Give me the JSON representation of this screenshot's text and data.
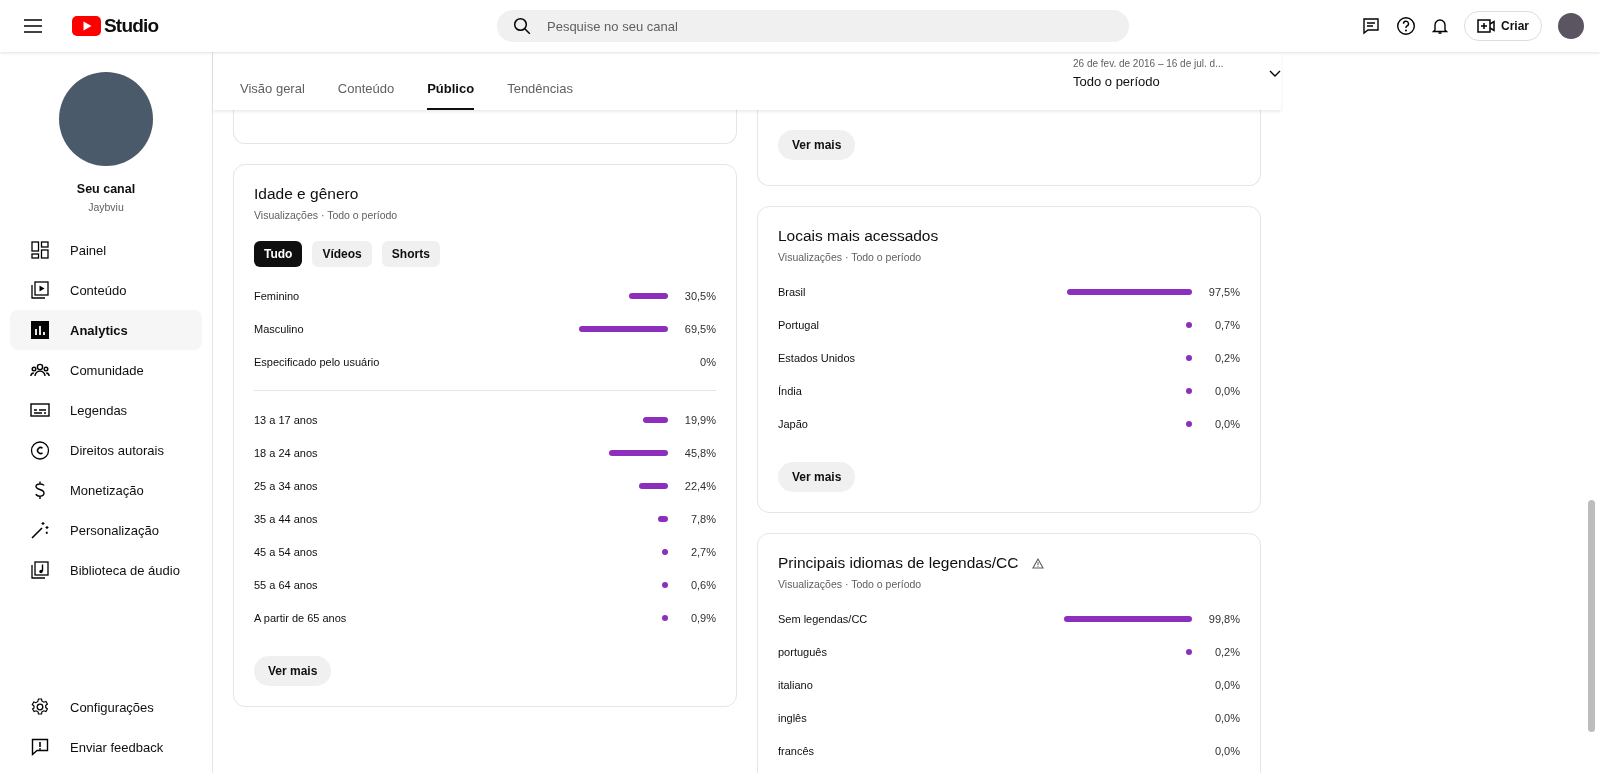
{
  "header": {
    "logo_text": "Studio",
    "search": {
      "placeholder": "Pesquise no seu canal"
    },
    "create_button": "Criar"
  },
  "sidebar": {
    "channel": {
      "title": "Seu canal",
      "name": "Jaybviu"
    },
    "items": [
      {
        "label": "Painel",
        "selected": false
      },
      {
        "label": "Conteúdo",
        "selected": false
      },
      {
        "label": "Analytics",
        "selected": true
      },
      {
        "label": "Comunidade",
        "selected": false
      },
      {
        "label": "Legendas",
        "selected": false
      },
      {
        "label": "Direitos autorais",
        "selected": false
      },
      {
        "label": "Monetização",
        "selected": false
      },
      {
        "label": "Personalização",
        "selected": false
      },
      {
        "label": "Biblioteca de áudio",
        "selected": false
      }
    ],
    "footer_items": [
      {
        "label": "Configurações"
      },
      {
        "label": "Enviar feedback"
      }
    ]
  },
  "tabs": [
    {
      "label": "Visão geral",
      "selected": false
    },
    {
      "label": "Conteúdo",
      "selected": false
    },
    {
      "label": "Público",
      "selected": true
    },
    {
      "label": "Tendências",
      "selected": false
    }
  ],
  "date_range": {
    "range": "26 de fev. de 2016 – 16 de jul. d...",
    "period": "Todo o período"
  },
  "left_column": [
    {
      "kind": "stub"
    },
    {
      "kind": "card",
      "title": "Idade e gênero",
      "subtitle": "Visualizações · Todo o período",
      "filters": [
        {
          "label": "Tudo",
          "selected": true
        },
        {
          "label": "Vídeos",
          "selected": false
        },
        {
          "label": "Shorts",
          "selected": false
        }
      ],
      "groups": [
        [
          {
            "label": "Feminino",
            "value": "30,5%",
            "kind": "bar"
          },
          {
            "label": "Masculino",
            "value": "69,5%",
            "kind": "bar"
          },
          {
            "label": "Especificado pelo usuário",
            "value": "0%",
            "kind": "none"
          }
        ],
        [
          {
            "label": "13 a 17 anos",
            "value": "19,9%",
            "kind": "bar"
          },
          {
            "label": "18 a 24 anos",
            "value": "45,8%",
            "kind": "bar"
          },
          {
            "label": "25 a 34 anos",
            "value": "22,4%",
            "kind": "bar"
          },
          {
            "label": "35 a 44 anos",
            "value": "7,8%",
            "kind": "bar"
          },
          {
            "label": "45 a 54 anos",
            "value": "2,7%",
            "kind": "dot"
          },
          {
            "label": "55 a 64 anos",
            "value": "0,6%",
            "kind": "dot"
          },
          {
            "label": "A partir de 65 anos",
            "value": "0,9%",
            "kind": "dot"
          }
        ]
      ],
      "button": "Ver mais"
    }
  ],
  "right_column": [
    {
      "kind": "stub",
      "button": "Ver mais"
    },
    {
      "kind": "card",
      "title": "Locais mais acessados",
      "subtitle": "Visualizações · Todo o período",
      "groups": [
        [
          {
            "label": "Brasil",
            "value": "97,5%",
            "kind": "bar"
          },
          {
            "label": "Portugal",
            "value": "0,7%",
            "kind": "dot"
          },
          {
            "label": "Estados Unidos",
            "value": "0,2%",
            "kind": "dot"
          },
          {
            "label": "Índia",
            "value": "0,0%",
            "kind": "dot"
          },
          {
            "label": "Japão",
            "value": "0,0%",
            "kind": "dot"
          }
        ]
      ],
      "button": "Ver mais"
    },
    {
      "kind": "card",
      "title": "Principais idiomas de legendas/CC",
      "subtitle": "Visualizações · Todo o período",
      "warning": true,
      "groups": [
        [
          {
            "label": "Sem legendas/CC",
            "value": "99,8%",
            "kind": "bar"
          },
          {
            "label": "português",
            "value": "0,2%",
            "kind": "dot"
          },
          {
            "label": "italiano",
            "value": "0,0%",
            "kind": "none"
          },
          {
            "label": "inglês",
            "value": "0,0%",
            "kind": "none"
          },
          {
            "label": "francês",
            "value": "0,0%",
            "kind": "none"
          }
        ]
      ]
    }
  ]
}
